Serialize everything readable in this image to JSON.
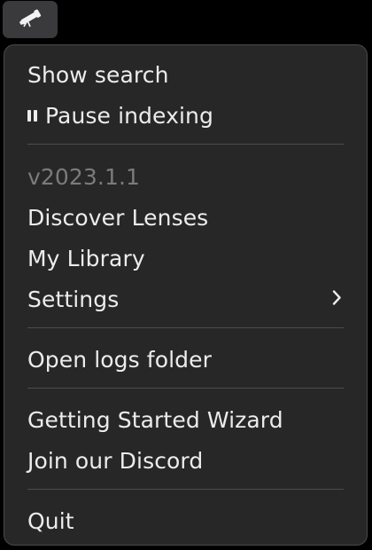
{
  "menubar": {
    "icon": "telescope-icon"
  },
  "menu": {
    "show_search": "Show search",
    "pause_icon": "pause-icon",
    "pause_indexing": "Pause indexing",
    "version": "v2023.1.1",
    "discover_lenses": "Discover Lenses",
    "my_library": "My Library",
    "settings": "Settings",
    "settings_submenu_icon": "chevron-right-icon",
    "open_logs_folder": "Open logs folder",
    "getting_started_wizard": "Getting Started Wizard",
    "join_discord": "Join our Discord",
    "quit": "Quit"
  },
  "colors": {
    "menu_background": "#272727",
    "text": "#ececec",
    "disabled_text": "#7b7b7b",
    "separator": "#4c4c4c"
  }
}
